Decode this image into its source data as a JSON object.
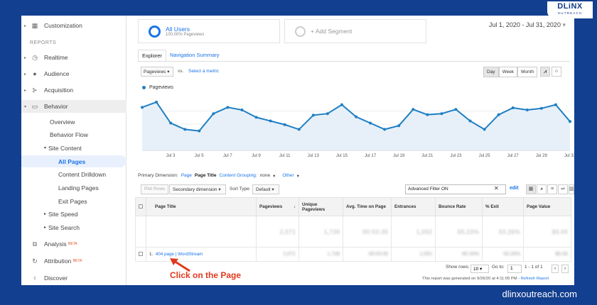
{
  "logo": {
    "name": "DLiNX",
    "tagline": "OUTREACH"
  },
  "brand_url": "dlinxoutreach.com",
  "callout_text": "Click on the Page",
  "sidebar": {
    "customization": "Customization",
    "reports_label": "REPORTS",
    "realtime": "Realtime",
    "audience": "Audience",
    "acquisition": "Acquisition",
    "behavior": "Behavior",
    "overview": "Overview",
    "behavior_flow": "Behavior Flow",
    "site_content": "Site Content",
    "all_pages": "All Pages",
    "content_drilldown": "Content Drilldown",
    "landing_pages": "Landing Pages",
    "exit_pages": "Exit Pages",
    "site_speed": "Site Speed",
    "site_search": "Site Search",
    "analysis": "Analysis",
    "attribution": "Attribution",
    "beta": "BETA",
    "discover": "Discover"
  },
  "segments": {
    "all_users": "All Users",
    "all_users_sub": "100.00% Pageviews",
    "add_segment": "+ Add Segment"
  },
  "date_range": "Jul 1, 2020 - Jul 31, 2020",
  "tabs": {
    "explorer": "Explorer",
    "navigation_summary": "Navigation Summary"
  },
  "metric": {
    "selected": "Pageviews",
    "vs": "vs.",
    "select_metric": "Select a metric"
  },
  "granularity": {
    "day": "Day",
    "week": "Week",
    "month": "Month"
  },
  "chart_data": {
    "type": "area",
    "series": [
      {
        "name": "Pageviews",
        "values": [
          0.82,
          0.92,
          0.52,
          0.4,
          0.37,
          0.7,
          0.82,
          0.77,
          0.63,
          0.56,
          0.49,
          0.4,
          0.67,
          0.7,
          0.87,
          0.64,
          0.52,
          0.4,
          0.47,
          0.78,
          0.68,
          0.7,
          0.78,
          0.56,
          0.4,
          0.68,
          0.81,
          0.77,
          0.8,
          0.87,
          0.55
        ]
      }
    ],
    "x": [
      "Jul 1",
      "Jul 2",
      "Jul 3",
      "Jul 4",
      "Jul 5",
      "Jul 6",
      "Jul 7",
      "Jul 8",
      "Jul 9",
      "Jul 10",
      "Jul 11",
      "Jul 12",
      "Jul 13",
      "Jul 14",
      "Jul 15",
      "Jul 16",
      "Jul 17",
      "Jul 18",
      "Jul 19",
      "Jul 20",
      "Jul 21",
      "Jul 22",
      "Jul 23",
      "Jul 24",
      "Jul 25",
      "Jul 26",
      "Jul 27",
      "Jul 28",
      "Jul 29",
      "Jul 30",
      "Jul 31"
    ],
    "tick_labels": [
      "Jul 3",
      "Jul 5",
      "Jul 7",
      "Jul 9",
      "Jul 11",
      "Jul 13",
      "Jul 15",
      "Jul 17",
      "Jul 19",
      "Jul 21",
      "Jul 23",
      "Jul 25",
      "Jul 27",
      "Jul 29",
      "Jul 31"
    ],
    "ylim": [
      0,
      1
    ],
    "grid": true,
    "legend": "top-left"
  },
  "dimension": {
    "primary_label": "Primary Dimension:",
    "page": "Page",
    "page_title": "Page Title",
    "content_grouping": "Content Grouping:",
    "none": "none",
    "other": "Other"
  },
  "toolbar": {
    "plot_rows": "Plot Rows",
    "secondary_dimension": "Secondary dimension",
    "sort_type_label": "Sort Type:",
    "sort_type_value": "Default",
    "filter_value": "Advanced Filter ON",
    "edit": "edit"
  },
  "table": {
    "headers": [
      "Page Title",
      "Pageviews",
      "Unique Pageviews",
      "Avg. Time on Page",
      "Entrances",
      "Bounce Rate",
      "% Exit",
      "Page Value"
    ],
    "totals": [
      "2,071",
      "1,739",
      "00:03:35",
      "1,052",
      "65.33%",
      "53.26%",
      "$0.00"
    ],
    "row": {
      "index": "1.",
      "title": "404 page | WordStream",
      "values": [
        "2,071",
        "1,739",
        "00:03:35",
        "1,052",
        "65.33%",
        "53.26%",
        "$0.00"
      ]
    }
  },
  "pagination": {
    "show_rows_label": "Show rows:",
    "show_rows_value": "10",
    "goto_label": "Go to:",
    "goto_value": "1",
    "range": "1 - 1 of 1",
    "generated": "This report was generated on 9/26/20 at 4:11:05 PM -",
    "refresh": "Refresh Report"
  }
}
